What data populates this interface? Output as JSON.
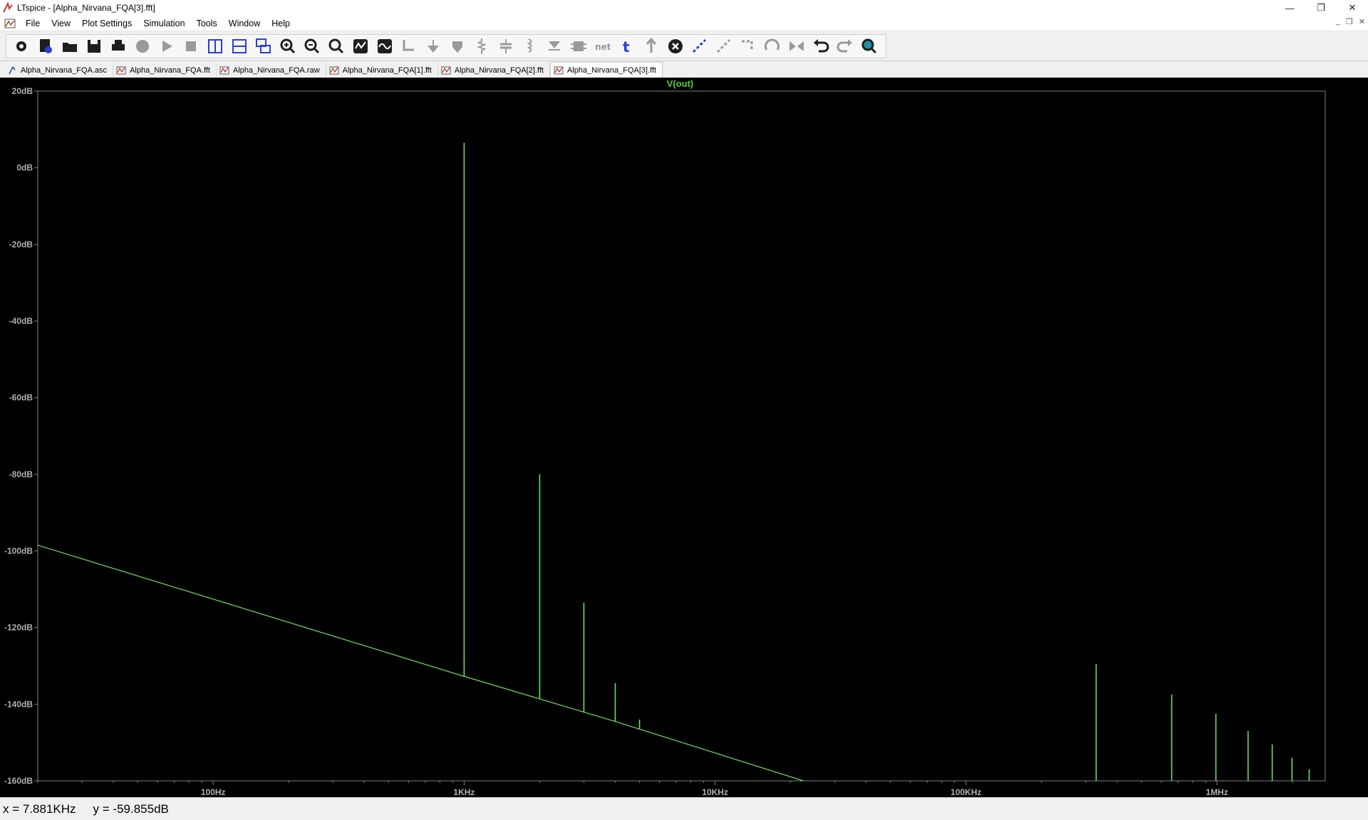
{
  "window": {
    "title": "LTspice - [Alpha_Nirvana_FQA[3].fft]",
    "minimize_glyph": "—",
    "maximize_glyph": "❐",
    "close_glyph": "✕"
  },
  "menubar": {
    "items": [
      "File",
      "View",
      "Plot Settings",
      "Simulation",
      "Tools",
      "Window",
      "Help"
    ],
    "mdi_controls": [
      "_",
      "❐",
      "✕"
    ]
  },
  "toolbar": {
    "buttons": [
      "settings-icon",
      "new-schematic-icon",
      "open-icon",
      "save-icon",
      "print-icon",
      "halt-icon",
      "run-icon",
      "stop-icon",
      "vertical-split-icon",
      "horizontal-split-icon",
      "cascade-icon",
      "zoom-in-icon",
      "zoom-out-icon",
      "zoom-fit-icon",
      "autorange-icon",
      "waveform-icon",
      "wire-icon",
      "ground-icon",
      "label-icon",
      "resistor-icon",
      "capacitor-icon",
      "inductor-icon",
      "diode-icon",
      "component-icon",
      "net-icon",
      "text-icon",
      "spice-directive-icon",
      "delete-icon",
      "duplicate-icon",
      "move-icon",
      "drag-icon",
      "rotate-icon",
      "mirror-icon",
      "undo-icon",
      "redo-icon",
      "find-icon"
    ]
  },
  "tabs": [
    {
      "label": "Alpha_Nirvana_FQA.asc",
      "icon": "schematic-icon",
      "active": false
    },
    {
      "label": "Alpha_Nirvana_FQA.fft",
      "icon": "waveform-tab-icon",
      "active": false
    },
    {
      "label": "Alpha_Nirvana_FQA.raw",
      "icon": "waveform-tab-icon",
      "active": false
    },
    {
      "label": "Alpha_Nirvana_FQA[1].fft",
      "icon": "waveform-tab-icon",
      "active": false
    },
    {
      "label": "Alpha_Nirvana_FQA[2].fft",
      "icon": "waveform-tab-icon",
      "active": false
    },
    {
      "label": "Alpha_Nirvana_FQA[3].fft",
      "icon": "waveform-tab-icon",
      "active": true
    }
  ],
  "colors": {
    "plot_background": "#000000",
    "trace": "#6fe25a",
    "axis": "#808080",
    "tick_label": "#b0b0b0",
    "trace_label": "#52d43a"
  },
  "chart_data": {
    "type": "line",
    "title": "V(out)",
    "xlabel": "",
    "ylabel": "",
    "x_scale": "log",
    "xlim": [
      20,
      2700000
    ],
    "ylim": [
      -160,
      20
    ],
    "x_ticks": [
      {
        "value": 100,
        "label": "100Hz"
      },
      {
        "value": 1000,
        "label": "1KHz"
      },
      {
        "value": 10000,
        "label": "10KHz"
      },
      {
        "value": 100000,
        "label": "100KHz"
      },
      {
        "value": 1000000,
        "label": "1MHz"
      }
    ],
    "y_ticks": [
      {
        "value": 20,
        "label": "20dB"
      },
      {
        "value": 0,
        "label": "0dB"
      },
      {
        "value": -20,
        "label": "-20dB"
      },
      {
        "value": -40,
        "label": "-40dB"
      },
      {
        "value": -60,
        "label": "-60dB"
      },
      {
        "value": -80,
        "label": "-80dB"
      },
      {
        "value": -100,
        "label": "-100dB"
      },
      {
        "value": -120,
        "label": "-120dB"
      },
      {
        "value": -140,
        "label": "-140dB"
      },
      {
        "value": -160,
        "label": "-160dB"
      }
    ],
    "grid": false,
    "series": [
      {
        "name": "V(out)",
        "noise_floor": [
          {
            "x": 20,
            "y": -98.5
          },
          {
            "x": 975,
            "y": -132.5
          },
          {
            "x": 4000,
            "y": -144.5
          },
          {
            "x": 22500,
            "y": -160
          }
        ],
        "peaks": [
          {
            "x": 1000,
            "y": 6.5
          },
          {
            "x": 2000,
            "y": -80
          },
          {
            "x": 3000,
            "y": -113.5
          },
          {
            "x": 4000,
            "y": -134.5
          },
          {
            "x": 5000,
            "y": -144
          },
          {
            "x": 330000,
            "y": -129.5
          },
          {
            "x": 660000,
            "y": -137.5
          },
          {
            "x": 990000,
            "y": -142.5
          },
          {
            "x": 1330000,
            "y": -147
          },
          {
            "x": 1660000,
            "y": -150.5
          },
          {
            "x": 1990000,
            "y": -154
          },
          {
            "x": 2330000,
            "y": -157
          }
        ]
      }
    ]
  },
  "status": {
    "x_readout": "x = 7.881KHz",
    "y_readout": "y = -59.855dB"
  }
}
